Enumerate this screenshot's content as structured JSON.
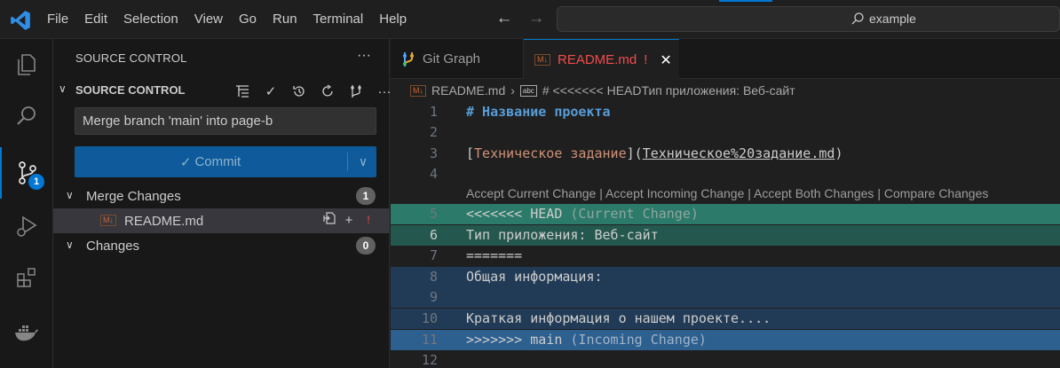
{
  "menu": [
    "File",
    "Edit",
    "Selection",
    "View",
    "Go",
    "Run",
    "Terminal",
    "Help"
  ],
  "search": {
    "text": "example"
  },
  "activity_bar": {
    "items": [
      "explorer-icon",
      "search-icon",
      "source-control-icon",
      "run-debug-icon",
      "extensions-icon",
      "docker-icon"
    ],
    "source_control_badge": "1"
  },
  "sidebar": {
    "title": "SOURCE CONTROL",
    "more": "···",
    "section_label": "SOURCE CONTROL",
    "commit_message": "Merge branch 'main' into page-b",
    "commit_button": "Commit",
    "merge_changes": {
      "label": "Merge Changes",
      "count": "1"
    },
    "file": {
      "name": "README.md",
      "status": "!"
    },
    "changes": {
      "label": "Changes",
      "count": "0"
    }
  },
  "tabs": [
    {
      "label": "Git Graph"
    },
    {
      "label": "README.md",
      "status": "!"
    }
  ],
  "breadcrumb": {
    "file": "README.md",
    "symbol": "# <<<<<<< HEADТип приложения: Веб-сайт"
  },
  "editor": {
    "codelens": "Accept Current Change | Accept Incoming Change | Accept Both Changes | Compare Changes",
    "lines": [
      {
        "n": "1",
        "text": "# Название проекта"
      },
      {
        "n": "2",
        "text": ""
      },
      {
        "n": "3",
        "text": "[Техническое задание](Техническое%20задание.md)"
      },
      {
        "n": "4",
        "text": ""
      },
      {
        "n": "5",
        "text": "<<<<<<< HEAD",
        "note": " (Current Change)"
      },
      {
        "n": "6",
        "text": "Тип приложения: Веб-сайт"
      },
      {
        "n": "7",
        "text": "======="
      },
      {
        "n": "8",
        "text": "Общая информация:"
      },
      {
        "n": "9",
        "text": ""
      },
      {
        "n": "10",
        "text": "Краткая информация о нашем проекте...."
      },
      {
        "n": "11",
        "text": ">>>>>>> main",
        "note": " (Incoming Change)"
      },
      {
        "n": "12",
        "text": ""
      }
    ]
  },
  "colors": {
    "accent": "#0078d4",
    "modified_red": "#f14c4c",
    "current_change": "#24584f",
    "incoming_change": "#213b56"
  }
}
